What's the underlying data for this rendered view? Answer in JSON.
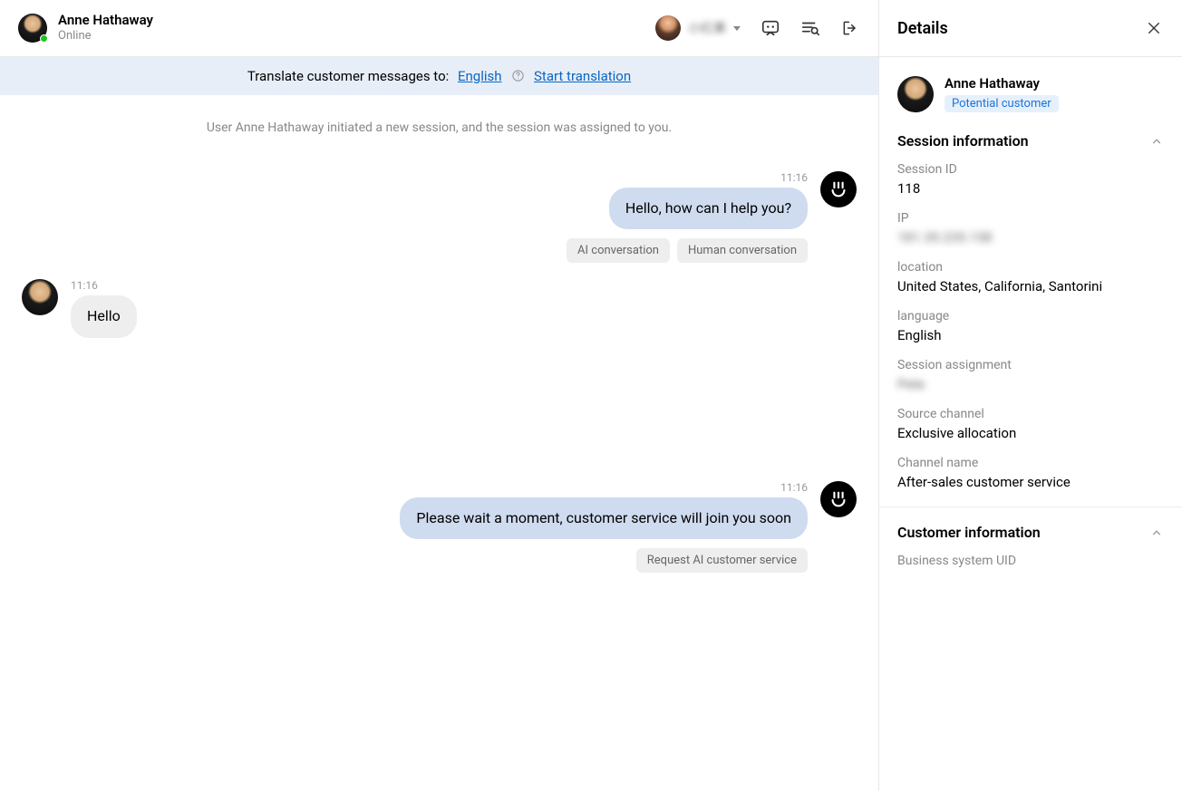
{
  "header": {
    "customer_name": "Anne Hathaway",
    "status": "Online",
    "transfer_name": "小红果"
  },
  "translate_bar": {
    "label": "Translate customer messages to:",
    "language": "English",
    "start": "Start translation"
  },
  "system_message": "User Anne Hathaway initiated a new session, and the session was assigned to you.",
  "messages": {
    "m1": {
      "time": "11:16",
      "text": "Hello, how can I help you?",
      "tags": {
        "ai": "AI conversation",
        "human": "Human conversation"
      }
    },
    "m2": {
      "time": "11:16",
      "text": "Hello"
    },
    "m3": {
      "time": "11:16",
      "text": "Please wait a moment, customer service will join you soon",
      "tags": {
        "request_ai": "Request AI customer service"
      }
    }
  },
  "details": {
    "title": "Details",
    "customer": {
      "name": "Anne Hathaway",
      "badge": "Potential customer"
    },
    "session": {
      "title": "Session information",
      "fields": {
        "session_id": {
          "label": "Session ID",
          "value": "118"
        },
        "ip": {
          "label": "IP",
          "value": "181.35.235.158"
        },
        "location": {
          "label": "location",
          "value": "United States, California, Santorini"
        },
        "language": {
          "label": "language",
          "value": "English"
        },
        "assignment": {
          "label": "Session assignment",
          "value": "Pete"
        },
        "source": {
          "label": "Source channel",
          "value": "Exclusive allocation"
        },
        "channel_name": {
          "label": "Channel name",
          "value": "After-sales customer service"
        }
      }
    },
    "customer_info": {
      "title": "Customer information",
      "uid_label": "Business system UID"
    }
  }
}
